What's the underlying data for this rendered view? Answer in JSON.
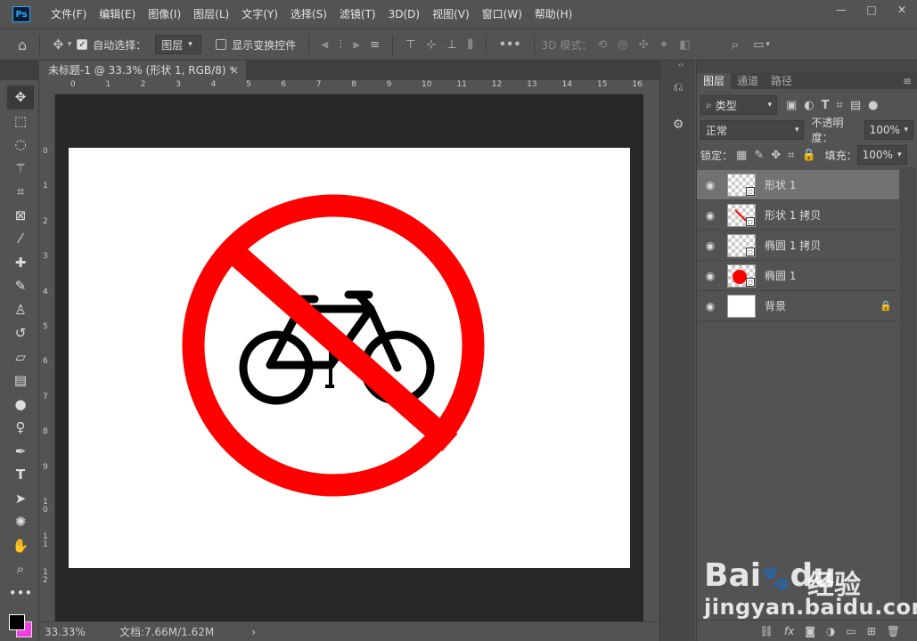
{
  "menubar": {
    "logo": "Ps",
    "items": [
      "文件(F)",
      "编辑(E)",
      "图像(I)",
      "图层(L)",
      "文字(Y)",
      "选择(S)",
      "滤镜(T)",
      "3D(D)",
      "视图(V)",
      "窗口(W)",
      "帮助(H)"
    ],
    "window_buttons": [
      "—",
      "□",
      "✕"
    ]
  },
  "options": {
    "auto_select_label": "自动选择：",
    "auto_select_target": "图层",
    "transform_controls_label": "显示变换控件",
    "more_label": "•••",
    "mode_3d_label": "3D 模式："
  },
  "document": {
    "tab_title": "未标题-1 @ 33.3% (形状 1, RGB/8) *",
    "tab_close": "×",
    "ruler_top": [
      "0",
      "1",
      "2",
      "3",
      "4",
      "5",
      "6",
      "7",
      "8",
      "9",
      "10",
      "11",
      "12",
      "13",
      "14",
      "15",
      "16"
    ],
    "ruler_left": [
      "0",
      "1",
      "2",
      "3",
      "4",
      "5",
      "6",
      "7",
      "8",
      "9",
      "10",
      "11",
      "12"
    ],
    "canvas_background": "#ffffff",
    "sign_color": "#ff0000",
    "bicycle_color": "#000000"
  },
  "status": {
    "zoom": "33.33%",
    "doc_info": "文档:7.66M/1.62M",
    "arrow": "›"
  },
  "colors": {
    "foreground": "#000000",
    "background": "#f03ee0"
  },
  "layers_panel": {
    "tabs": [
      "图层",
      "通道",
      "路径"
    ],
    "filter_label": "类型",
    "blend_mode": "正常",
    "opacity_label": "不透明度：",
    "opacity_value": "100%",
    "lock_label": "锁定：",
    "fill_label": "填充：",
    "fill_value": "100%",
    "layers": [
      {
        "name": "形状 1",
        "selected": true
      },
      {
        "name": "形状 1 拷贝",
        "selected": false
      },
      {
        "name": "椭圆 1 拷贝",
        "selected": false
      },
      {
        "name": "椭圆 1",
        "selected": false
      },
      {
        "name": "背景",
        "selected": false,
        "locked": true
      }
    ],
    "footer_icons": [
      "link-icon",
      "fx-icon",
      "mask-icon",
      "adjustment-icon",
      "group-icon",
      "new-layer-icon",
      "trash-icon"
    ]
  },
  "watermark": {
    "logo_text": "Bai",
    "logo_text2": "du",
    "cn": "经验",
    "url": "jingyan.baidu.com"
  }
}
